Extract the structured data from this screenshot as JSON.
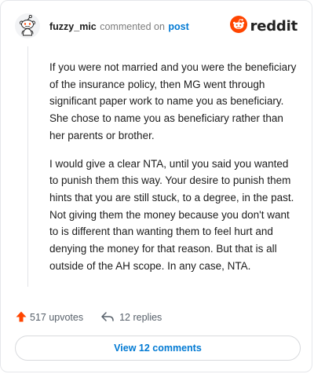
{
  "header": {
    "username": "fuzzy_mic",
    "action_text": "commented on",
    "post_link": "post",
    "brand_name": "reddit"
  },
  "comment": {
    "paragraphs": [
      "If you were not married and you were the beneficiary of the insurance policy, then MG went through significant paper work to name you as beneficiary. She chose to name you as beneficiary rather than her parents or brother.",
      "I would give a clear NTA, until you said you wanted to punish them this way. Your desire to punish them hints that you are still stuck, to a degree, in the past. Not giving them the money because you don't want to is different than wanting them to feel hurt and denying the money for that reason. But that is all outside of the AH scope. In any case, NTA."
    ]
  },
  "footer": {
    "upvotes_label": "517 upvotes",
    "replies_label": "12 replies"
  },
  "view_button": {
    "label": "View 12 comments"
  },
  "colors": {
    "brand_orange": "#ff4500",
    "link_blue": "#0079d3",
    "upvote_orange": "#ff4500",
    "muted_text": "#7c7c7c"
  },
  "icons": {
    "avatar": "snoo-avatar-icon",
    "brand": "reddit-logo-icon",
    "upvote": "upvote-arrow-icon",
    "reply": "reply-arrow-icon"
  }
}
